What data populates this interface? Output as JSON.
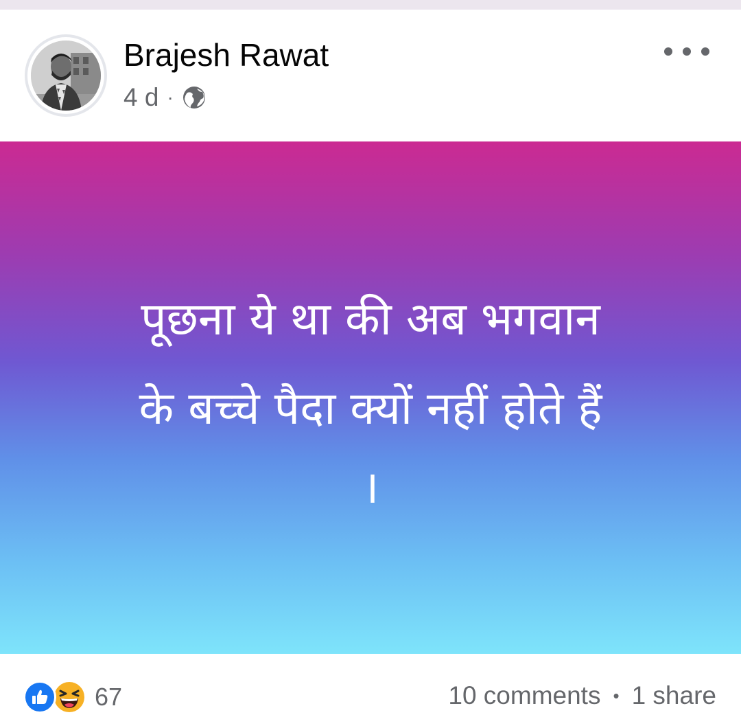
{
  "post": {
    "author": "Brajesh Rawat",
    "time": "4 d",
    "meta_separator": "·",
    "privacy_icon": "globe-icon",
    "more_icon": "more-options-icon",
    "text_lines": [
      "पूछना ये था की अब भगवान",
      "के बच्चे पैदा क्यों नहीं होते हैं",
      "।"
    ],
    "background_gradient": [
      "#cb2a92",
      "#6f58d2",
      "#7ee4fb"
    ]
  },
  "footer": {
    "reaction_icons": [
      "like-icon",
      "haha-icon"
    ],
    "reaction_count": "67",
    "comments": "10 comments",
    "separator": "•",
    "shares": "1 share"
  },
  "colors": {
    "like_blue": "#1877f2",
    "haha_yellow": "#f7b125",
    "secondary_text": "#65676b"
  }
}
